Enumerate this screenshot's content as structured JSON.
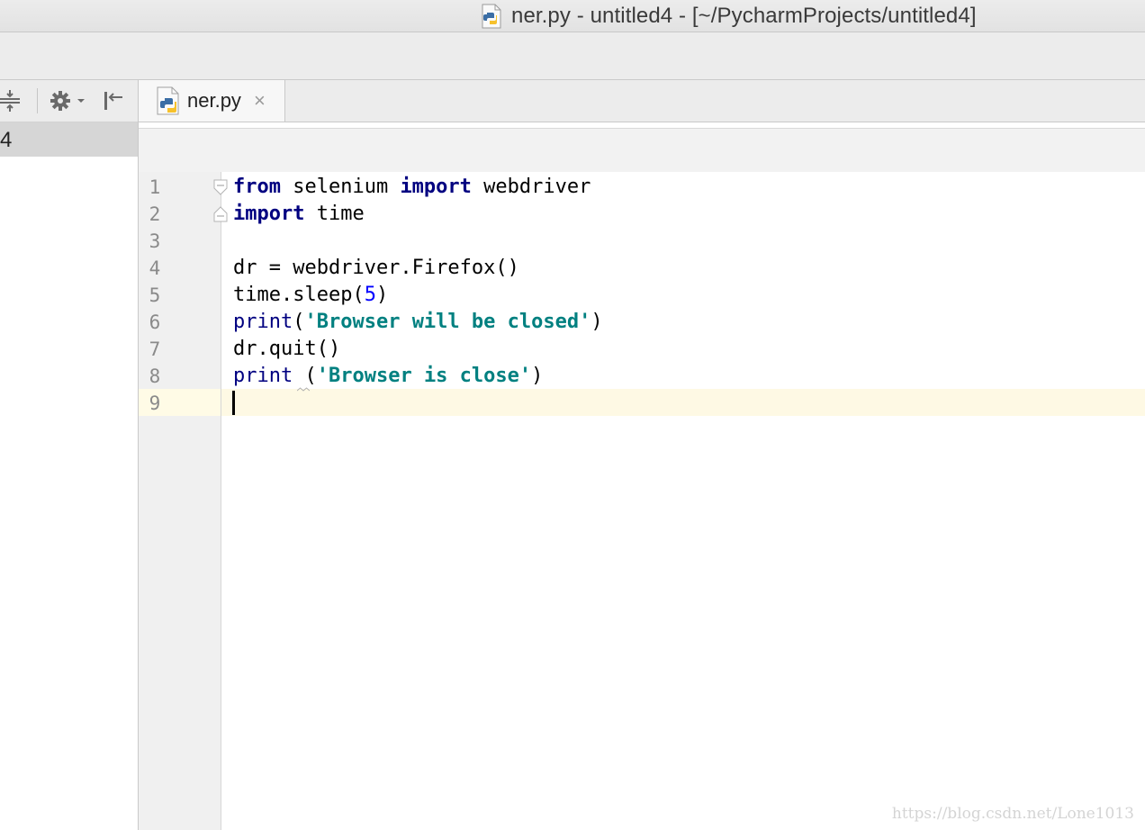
{
  "window": {
    "title": "ner.py - untitled4 - [~/PycharmProjects/untitled4]",
    "file_icon": "python-file-icon"
  },
  "project_panel": {
    "toolbar_icons": [
      "collapse-all-icon",
      "gear-icon",
      "hide-panel-icon"
    ],
    "tree_row_text": "4"
  },
  "tabs": [
    {
      "label": "ner.py",
      "icon": "python-file-icon",
      "close": "×",
      "active": true
    }
  ],
  "editor": {
    "line_numbers": [
      "1",
      "2",
      "3",
      "4",
      "5",
      "6",
      "7",
      "8",
      "9"
    ],
    "current_line": 9,
    "code_lines": [
      [
        {
          "t": "from",
          "c": "kw"
        },
        {
          "t": " selenium ",
          "c": ""
        },
        {
          "t": "import",
          "c": "kw"
        },
        {
          "t": " webdriver",
          "c": ""
        }
      ],
      [
        {
          "t": "import",
          "c": "kw"
        },
        {
          "t": " time",
          "c": ""
        }
      ],
      [],
      [
        {
          "t": "dr = webdriver.Firefox()",
          "c": ""
        }
      ],
      [
        {
          "t": "time.sleep(",
          "c": ""
        },
        {
          "t": "5",
          "c": "num"
        },
        {
          "t": ")",
          "c": ""
        }
      ],
      [
        {
          "t": "print",
          "c": "bi"
        },
        {
          "t": "(",
          "c": ""
        },
        {
          "t": "'Browser will be closed'",
          "c": "str"
        },
        {
          "t": ")",
          "c": ""
        }
      ],
      [
        {
          "t": "dr.quit()",
          "c": ""
        }
      ],
      [
        {
          "t": "print",
          "c": "bi"
        },
        {
          "t": " (",
          "c": ""
        },
        {
          "t": "'Browser is close'",
          "c": "str"
        },
        {
          "t": ")",
          "c": ""
        }
      ],
      []
    ],
    "colors": {
      "keyword": "#000080",
      "string": "#008080",
      "number": "#0000ff",
      "current_line_bg": "#fef9e4"
    }
  },
  "watermark": "https://blog.csdn.net/Lone1013"
}
